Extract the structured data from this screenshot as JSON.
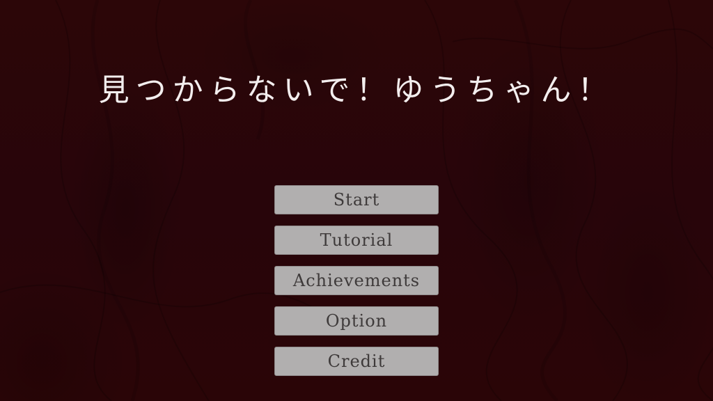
{
  "title": "見つからないで！ゆうちゃん！",
  "menu": {
    "items": [
      {
        "label": "Start"
      },
      {
        "label": "Tutorial"
      },
      {
        "label": "Achievements"
      },
      {
        "label": "Option"
      },
      {
        "label": "Credit"
      }
    ]
  },
  "colors": {
    "background": "#2a0507",
    "title_text": "#f3eeee",
    "button_fill": "#b1afaf",
    "button_text": "#3e3a3a"
  }
}
